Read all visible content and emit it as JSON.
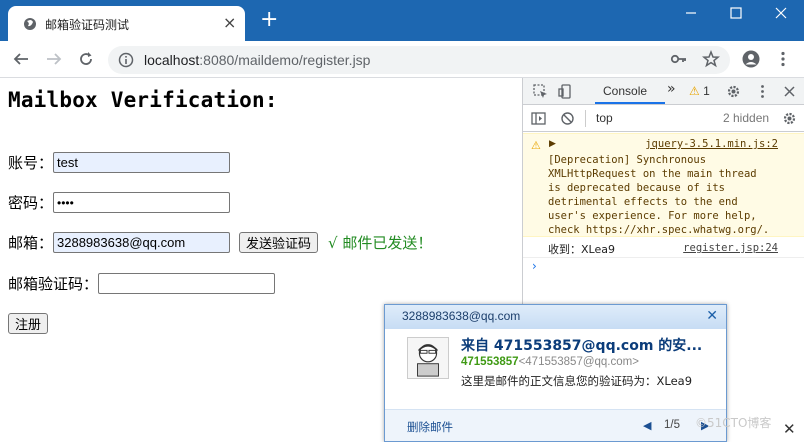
{
  "browser": {
    "tab_title": "邮箱验证码测试",
    "new_tab": "+",
    "url_host": "localhost",
    "url_rest": ":8080/maildemo/register.jsp"
  },
  "page": {
    "heading": "Mailbox Verification:",
    "account_label": "账号：",
    "account_value": "test",
    "password_label": "密码：",
    "password_value": "••••",
    "email_label": "邮箱：",
    "email_value": "3288983638@qq.com",
    "send_code_button": "发送验证码",
    "sent_status": "√ 邮件已发送！",
    "code_label": "邮箱验证码：",
    "code_value": "",
    "register_button": "注册"
  },
  "devtools": {
    "console_tab": "Console",
    "more": "»",
    "warning_count": "1",
    "context": "top",
    "hidden_count": "2 hidden",
    "warning_source": "jquery-3.5.1.min.js:2",
    "warning_text": "[Deprecation] Synchronous\nXMLHttpRequest on the main thread\nis deprecated because of its\ndetrimental effects to the end\nuser's experience. For more help,\ncheck https://xhr.spec.whatwg.org/.",
    "log_text": "收到：XLea9",
    "log_source": "register.jsp:24",
    "prompt": "›"
  },
  "notification": {
    "account": "3288983638@qq.com",
    "subject": "来自 471553857@qq.com 的安...",
    "sender_name": "471553857",
    "sender_addr": "<471553857@qq.com>",
    "body": "这里是邮件的正文信息您的验证码为：XLea9",
    "delete_label": "删除邮件",
    "page_indicator": "1/5"
  },
  "watermark": "©51CTO博客",
  "colors": {
    "titlebar": "#1d67b1",
    "sent_green": "#228b22",
    "autofill_bg": "#e8f0fe",
    "link_blue": "#1a73e8"
  }
}
